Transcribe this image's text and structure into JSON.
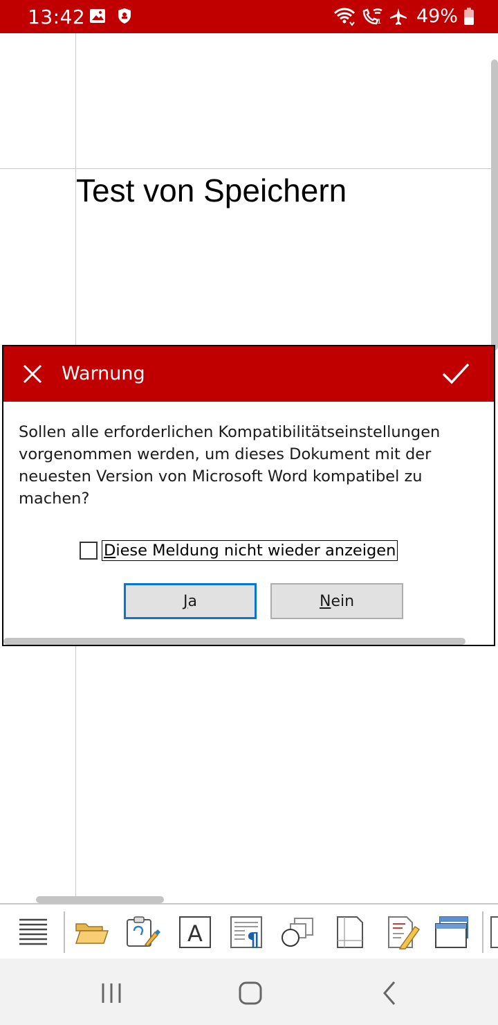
{
  "status_bar": {
    "time": "13:42",
    "battery_percent": "49%",
    "icons": [
      "gallery-icon",
      "shield-icon",
      "wifi-icon",
      "wifi-call-icon",
      "airplane-icon",
      "battery-icon"
    ]
  },
  "document": {
    "text": "Test von Speichern"
  },
  "dialog": {
    "title": "Warnung",
    "message": "Sollen alle erforderlichen Kompatibilitätseinstellungen vorgenommen werden, um dieses Dokument mit der neuesten Version von Microsoft Word kompatibel zu machen?",
    "checkbox": {
      "label_accel": "D",
      "label_rest": "iese Meldung nicht wieder anzeigen",
      "checked": false
    },
    "yes_button": {
      "accel": "J",
      "rest": "a"
    },
    "no_button": {
      "accel": "N",
      "rest": "ein"
    }
  },
  "toolbar": {
    "icons": [
      "menu-icon",
      "open-folder-icon",
      "paste-format-icon",
      "text-box-icon",
      "paragraph-icon",
      "shapes-icon",
      "page-icon",
      "edit-document-icon",
      "window-icon",
      "more-icon"
    ]
  },
  "colors": {
    "accent": "#c00000",
    "focus": "#0a74d0"
  }
}
